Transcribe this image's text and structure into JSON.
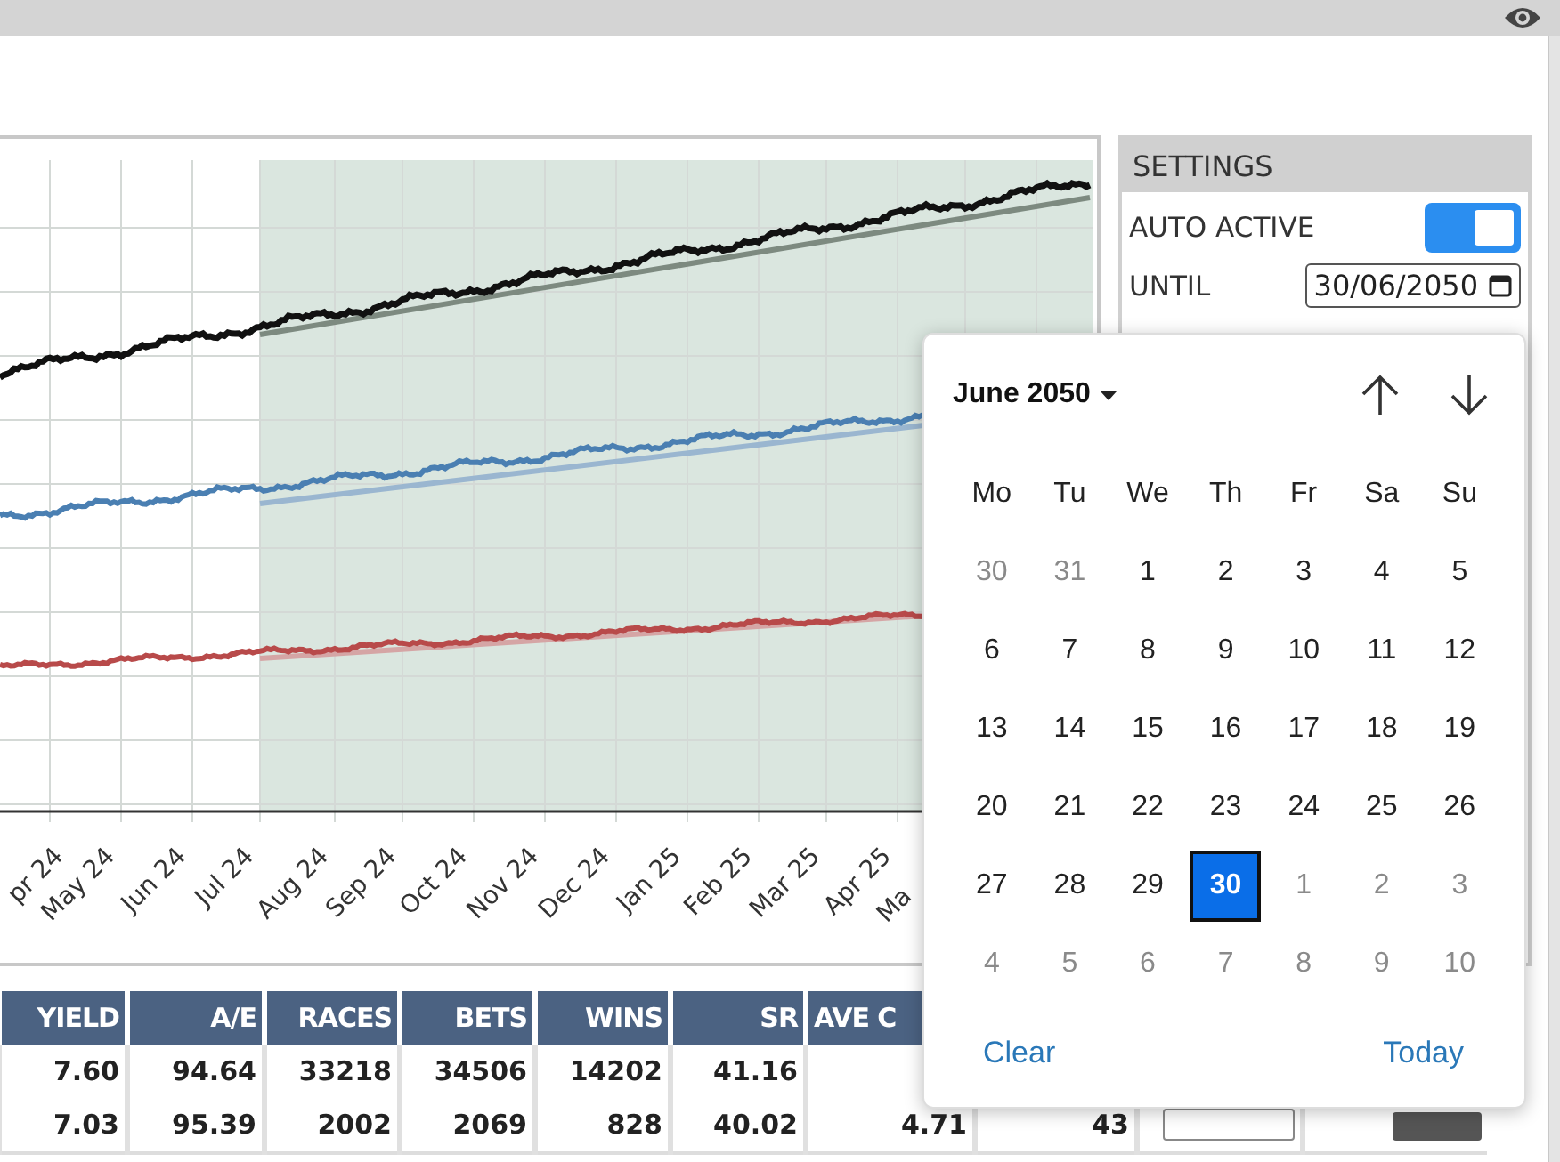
{
  "chart": {
    "x_labels": [
      "pr 24",
      "May 24",
      "Jun 24",
      "Jul 24",
      "Aug 24",
      "Sep 24",
      "Oct 24",
      "Nov 24",
      "Dec 24",
      "Jan 25",
      "Feb 25",
      "Mar 25",
      "Apr 25",
      "Ma"
    ]
  },
  "settings": {
    "title": "SETTINGS",
    "auto_active": {
      "label": "AUTO ACTIVE",
      "on": true
    },
    "until": {
      "label": "UNTIL",
      "value": "30/06/2050"
    }
  },
  "table": {
    "columns": [
      "YIELD",
      "A/E",
      "RACES",
      "BETS",
      "WINS",
      "SR",
      "AVE C"
    ],
    "rows": [
      {
        "cells": [
          "7.60",
          "94.64",
          "33218",
          "34506",
          "14202",
          "41.16"
        ]
      },
      {
        "cells": [
          "7.03",
          "95.39",
          "2002",
          "2069",
          "828",
          "40.02",
          "4.71",
          "43"
        ]
      }
    ]
  },
  "calendar": {
    "month": "June 2050",
    "weekdays": [
      "Mo",
      "Tu",
      "We",
      "Th",
      "Fr",
      "Sa",
      "Su"
    ],
    "weeks": [
      [
        {
          "day": "30",
          "muted": true,
          "selected": false
        },
        {
          "day": "31",
          "muted": true,
          "selected": false
        },
        {
          "day": "1",
          "muted": false,
          "selected": false
        },
        {
          "day": "2",
          "muted": false,
          "selected": false
        },
        {
          "day": "3",
          "muted": false,
          "selected": false
        },
        {
          "day": "4",
          "muted": false,
          "selected": false
        },
        {
          "day": "5",
          "muted": false,
          "selected": false
        }
      ],
      [
        {
          "day": "6",
          "muted": false,
          "selected": false
        },
        {
          "day": "7",
          "muted": false,
          "selected": false
        },
        {
          "day": "8",
          "muted": false,
          "selected": false
        },
        {
          "day": "9",
          "muted": false,
          "selected": false
        },
        {
          "day": "10",
          "muted": false,
          "selected": false
        },
        {
          "day": "11",
          "muted": false,
          "selected": false
        },
        {
          "day": "12",
          "muted": false,
          "selected": false
        }
      ],
      [
        {
          "day": "13",
          "muted": false,
          "selected": false
        },
        {
          "day": "14",
          "muted": false,
          "selected": false
        },
        {
          "day": "15",
          "muted": false,
          "selected": false
        },
        {
          "day": "16",
          "muted": false,
          "selected": false
        },
        {
          "day": "17",
          "muted": false,
          "selected": false
        },
        {
          "day": "18",
          "muted": false,
          "selected": false
        },
        {
          "day": "19",
          "muted": false,
          "selected": false
        }
      ],
      [
        {
          "day": "20",
          "muted": false,
          "selected": false
        },
        {
          "day": "21",
          "muted": false,
          "selected": false
        },
        {
          "day": "22",
          "muted": false,
          "selected": false
        },
        {
          "day": "23",
          "muted": false,
          "selected": false
        },
        {
          "day": "24",
          "muted": false,
          "selected": false
        },
        {
          "day": "25",
          "muted": false,
          "selected": false
        },
        {
          "day": "26",
          "muted": false,
          "selected": false
        }
      ],
      [
        {
          "day": "27",
          "muted": false,
          "selected": false
        },
        {
          "day": "28",
          "muted": false,
          "selected": false
        },
        {
          "day": "29",
          "muted": false,
          "selected": false
        },
        {
          "day": "30",
          "muted": false,
          "selected": true
        },
        {
          "day": "1",
          "muted": true,
          "selected": false
        },
        {
          "day": "2",
          "muted": true,
          "selected": false
        },
        {
          "day": "3",
          "muted": true,
          "selected": false
        }
      ],
      [
        {
          "day": "4",
          "muted": true,
          "selected": false
        },
        {
          "day": "5",
          "muted": true,
          "selected": false
        },
        {
          "day": "6",
          "muted": true,
          "selected": false
        },
        {
          "day": "7",
          "muted": true,
          "selected": false
        },
        {
          "day": "8",
          "muted": true,
          "selected": false
        },
        {
          "day": "9",
          "muted": true,
          "selected": false
        },
        {
          "day": "10",
          "muted": true,
          "selected": false
        }
      ]
    ],
    "clear": "Clear",
    "today": "Today"
  }
}
